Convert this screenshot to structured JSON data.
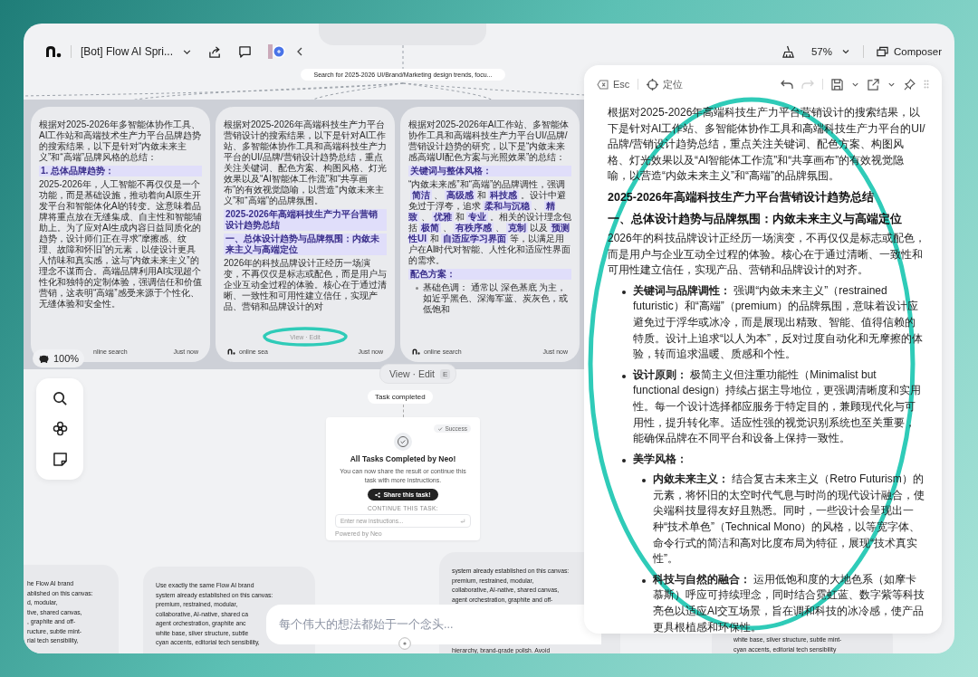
{
  "topbar": {
    "title": "[Bot] Flow AI Spri...",
    "zoom": "57%",
    "composer": "Composer"
  },
  "canvas": {
    "prompt": "Search for 2025-2026 UI/Brand/Marketing design trends, focu...",
    "cards": [
      {
        "blocks": [
          {
            "kind": "paragraph",
            "text": "根据对2025-2026年多智能体协作工具、AI工作站和高端技术生产力平台品牌趋势的搜索结果，以下是针对“内敛未来主义”和“高端”品牌风格的总结："
          },
          {
            "kind": "heading",
            "text": "1. 总体品牌趋势："
          },
          {
            "kind": "paragraph",
            "text": "2025-2026年，人工智能不再仅仅是一个功能，而是基础设施，推动着向AI原生开发平台和智能体化AI的转变。这意味着品牌将重点放在无缝集成、自主性和智能辅助上。为了应对AI生成内容日益同质化的趋势，设计师们正在寻求“摩擦感、纹理、故障和怀旧”的元素，以使设计更具人情味和真实感，这与“内敛未来主义”的理念不谋而合。高端品牌利用AI实现超个性化和独特的定制体验，强调信任和价值营销，这表明“高端”感受来源于个性化、无缝体验和安全性。"
          }
        ],
        "source": "nline search",
        "logo": false,
        "time": "Just now"
      },
      {
        "blocks": [
          {
            "kind": "paragraph",
            "text": "根据对2025-2026年高端科技生产力平台营销设计的搜索结果，以下是针对AI工作站、多智能体协作工具和高端科技生产力平台的UI/品牌/营销设计趋势总结，重点关注关键词、配色方案、构图风格、灯光效果以及“AI智能体工作流”和“共享画布”的有效视觉隐喻，以营造“内敛未来主义”和“高端”的品牌氛围。"
          },
          {
            "kind": "heading",
            "text": "2025-2026年高端科技生产力平台营销设计趋势总结"
          },
          {
            "kind": "heading",
            "text": "一、总体设计趋势与品牌氛围：内敛未来主义与高端定位"
          },
          {
            "kind": "paragraph",
            "text": "2026年的科技品牌设计正经历一场演变，不再仅仅是标志或配色，而是用户与企业互动全过程的体验。核心在于通过清晰、一致性和可用性建立信任，实现产品、营销和品牌设计的对"
          }
        ],
        "hover_label": "View · Edit",
        "source": "online sea",
        "logo": true,
        "time": "Just now"
      },
      {
        "blocks": [
          {
            "kind": "paragraph",
            "text": "根据对2025-2026年AI工作站、多智能体协作工具和高端科技生产力平台UI/品牌/营销设计趋势的研究，以下是“内敛未来感高端UI配色方案与光照效果”的总结："
          },
          {
            "kind": "heading",
            "text": "关键词与整体风格："
          },
          {
            "kind": "paragraph",
            "text": "“内敛未来感”和“高端”的品牌调性，强调**简洁**、**高级感**和**科技感**。设计中避免过于浮夸，追求**柔和与沉稳**、**精致**、**优雅**和**专业**。相关的设计理念包括**极简**、**有秩序感**、**克制**以及**预测性UI**和**自适应学习界面**等，以满足用户在AI时代对智能、人性化和适应性界面的需求。"
          },
          {
            "kind": "heading",
            "text": "配色方案："
          },
          {
            "kind": "bullet",
            "text": "基础色调： 通常以 深色基底 为主，如近乎黑色、深海军蓝、炭灰色，或低饱和"
          }
        ],
        "source": "online search",
        "logo": true,
        "time": "Just now"
      }
    ],
    "view_edit": {
      "label": "View · Edit",
      "key": "E"
    },
    "status": "Task completed",
    "success": {
      "badge": "Success",
      "title": "All Tasks Completed by Neo!",
      "text": "You can now share the result or continue this task with more instructions.",
      "button": "Share this task!",
      "continue_label": "CONTINUE THIS TASK:",
      "placeholder": "Enter new instructions...",
      "footer": "Powered by Neo"
    },
    "partial_cards": [
      {
        "lines": [
          "he Flow AI brand",
          "ablished on this canvas:",
          "d, modular,",
          "tive, shared canvas,",
          ", graphite and off-",
          "ructure, subtle mint-",
          "rial tech sensibility,"
        ]
      },
      {
        "lines": [
          "Use exactly the same Flow AI brand",
          "system already established on this canvas:",
          "premium, restrained, modular,",
          "collaborative, AI-native, shared ca",
          "agent orchestration, graphite anc",
          "white base, silver structure, subtle",
          "cyan accents, editorial tech sensibility,"
        ]
      },
      {
        "lines": [
          "system already established on this canvas:",
          "premium, restrained, modular,",
          "collaborative, AI-native, shared canvas,",
          "agent orchestration, graphite and off-"
        ],
        "tail_lines": [
          "hierarchy, brand-grade polish. Avoid"
        ]
      },
      {
        "lines": [
          "white base, silver structure, subtle mint-",
          "cyan accents, editorial tech sensibility"
        ]
      }
    ],
    "zoom_control": "100%",
    "composer_input": {
      "placeholder": "每个伟大的想法都始于一个念头..."
    }
  },
  "panel": {
    "esc": "Esc",
    "locate": "定位",
    "redo_disabled": true,
    "blocks": [
      {
        "kind": "paragraph",
        "text": "根据对2025-2026年高端科技生产力平台营销设计的搜索结果，以下是针对AI工作站、多智能体协作工具和高端科技生产力平台的UI/品牌/营销设计趋势总结，重点关注关键词、配色方案、构图风格、灯光效果以及“AI智能体工作流”和“共享画布”的有效视觉隐喻，以营造“内敛未来主义”和“高端”的品牌氛围。"
      },
      {
        "kind": "title",
        "text": "2025-2026年高端科技生产力平台营销设计趋势总结"
      },
      {
        "kind": "subtitle",
        "text": "一、总体设计趋势与品牌氛围：内敛未来主义与高端定位"
      },
      {
        "kind": "paragraph",
        "text": "2026年的科技品牌设计正经历一场演变，不再仅仅是标志或配色，而是用户与企业互动全过程的体验。核心在于通过清晰、一致性和可用性建立信任，实现产品、营销和品牌设计的对齐。"
      },
      {
        "kind": "bullet",
        "text": "**关键词与品牌调性：** 强调“内敛未来主义”（restrained futuristic）和“高端”（premium）的品牌氛围，意味着设计应避免过于浮华或冰冷，而是展现出精致、智能、值得信赖的特质。设计上追求“以人为本”，反对过度自动化和无摩擦的体验，转而追求温暖、质感和个性。"
      },
      {
        "kind": "bullet",
        "text": "**设计原则：** 极简主义但注重功能性（Minimalist but functional design）持续占据主导地位，更强调清晰度和实用性。每一个设计选择都应服务于特定目的，兼顾现代化与可用性，提升转化率。适应性强的视觉识别系统也至关重要，能确保品牌在不同平台和设备上保持一致性。"
      },
      {
        "kind": "bullet",
        "text": "**美学风格：**",
        "children": [
          {
            "text": "**内敛未来主义：** 结合复古未来主义（Retro Futurism）的元素，将怀旧的太空时代气息与时尚的现代设计融合，使尖端科技显得友好且熟悉。同时，一些设计会呈现出一种“技术单色”（Technical Mono）的风格，以等宽字体、命令行式的简洁和高对比度布局为特征，展现“技术真实性”。"
          },
          {
            "text": "**科技与自然的融合：** 运用低饱和度的大地色系（如摩卡慕斯）呼应可持续理念，同时结合霓虹蓝、数字紫等科技亮色以适应AI交互场景，旨在调和科技的冰冷感，使产品更具根植感和环保性。"
          }
        ]
      }
    ]
  }
}
